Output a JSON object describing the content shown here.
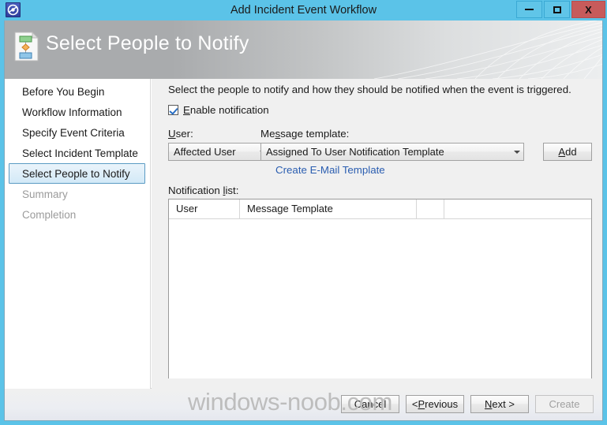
{
  "window": {
    "title": "Add Incident Event Workflow",
    "icon": "workflow-app-icon",
    "controls": {
      "minimize": "minimize-icon",
      "maximize": "maximize-icon",
      "close": "X"
    }
  },
  "header": {
    "title": "Select People to Notify",
    "icon": "workflow-document-icon"
  },
  "sidebar": {
    "items": [
      {
        "label": "Before You Begin",
        "state": "done"
      },
      {
        "label": "Workflow Information",
        "state": "done"
      },
      {
        "label": "Specify Event Criteria",
        "state": "done"
      },
      {
        "label": "Select Incident Template",
        "state": "done"
      },
      {
        "label": "Select People to Notify",
        "state": "selected"
      },
      {
        "label": "Summary",
        "state": "disabled"
      },
      {
        "label": "Completion",
        "state": "disabled"
      }
    ]
  },
  "content": {
    "intro": "Select the people to notify and how they should be notified when the event is triggered.",
    "enable_notification": {
      "label_before": "",
      "accel": "E",
      "label_after": "nable notification",
      "checked": true
    },
    "user_field": {
      "accel": "U",
      "label_after": "ser:",
      "value": "Affected User"
    },
    "template_field": {
      "label_before": "Me",
      "accel": "s",
      "label_after": "sage template:",
      "value": "Assigned To User Notification Template"
    },
    "add_button": {
      "accel": "A",
      "label_after": "dd"
    },
    "create_email_link": "Create E-Mail Template",
    "notification_list": {
      "label_before": "Notification ",
      "accel": "l",
      "label_after": "ist:",
      "columns": [
        "User",
        "Message Template",
        "",
        ""
      ],
      "rows": []
    }
  },
  "footer": {
    "buttons": [
      {
        "label_before": "Cancel",
        "accel": "",
        "label_after": "",
        "disabled": false
      },
      {
        "label_before": "< ",
        "accel": "P",
        "label_after": "revious",
        "disabled": false
      },
      {
        "label_before": "",
        "accel": "N",
        "label_after": "ext >",
        "disabled": false
      },
      {
        "label_before": "Create",
        "accel": "",
        "label_after": "",
        "disabled": true
      }
    ]
  },
  "watermark": "windows-noob.com",
  "colors": {
    "window_frame": "#5bc3e8",
    "close_button": "#c75b5b",
    "link": "#2a5db0",
    "selected_nav_border": "#5b9bc4",
    "content_bg": "#f0f0f0"
  }
}
